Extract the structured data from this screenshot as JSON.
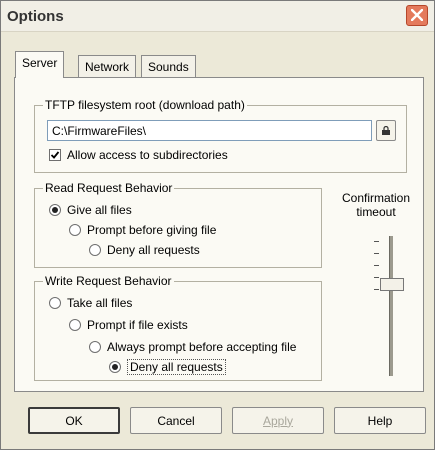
{
  "window": {
    "title": "Options"
  },
  "tabs": [
    {
      "label": "Server",
      "active": true
    },
    {
      "label": "Network",
      "active": false
    },
    {
      "label": "Sounds",
      "active": false
    }
  ],
  "tftp": {
    "legend": "TFTP filesystem root (download path)",
    "path_value": "C:\\FirmwareFiles\\",
    "allow_subdirs_label": "Allow access to subdirectories",
    "allow_subdirs_checked": true,
    "browse_icon": "lock-icon"
  },
  "read_behavior": {
    "legend": "Read Request Behavior",
    "options": [
      {
        "label": "Give all files",
        "selected": true
      },
      {
        "label": "Prompt before giving file",
        "selected": false
      },
      {
        "label": "Deny all requests",
        "selected": false
      }
    ]
  },
  "write_behavior": {
    "legend": "Write Request Behavior",
    "options": [
      {
        "label": "Take all files",
        "selected": false
      },
      {
        "label": "Prompt if file exists",
        "selected": false
      },
      {
        "label": "Always prompt before accepting file",
        "selected": false
      },
      {
        "label": "Deny all requests",
        "selected": true
      }
    ]
  },
  "confirmation": {
    "label_line1": "Confirmation",
    "label_line2": "timeout"
  },
  "buttons": {
    "ok": "OK",
    "cancel": "Cancel",
    "apply": "Apply",
    "help": "Help"
  },
  "colors": {
    "close_button": "#e47a5c",
    "dialog_background": "#ece9d8"
  }
}
